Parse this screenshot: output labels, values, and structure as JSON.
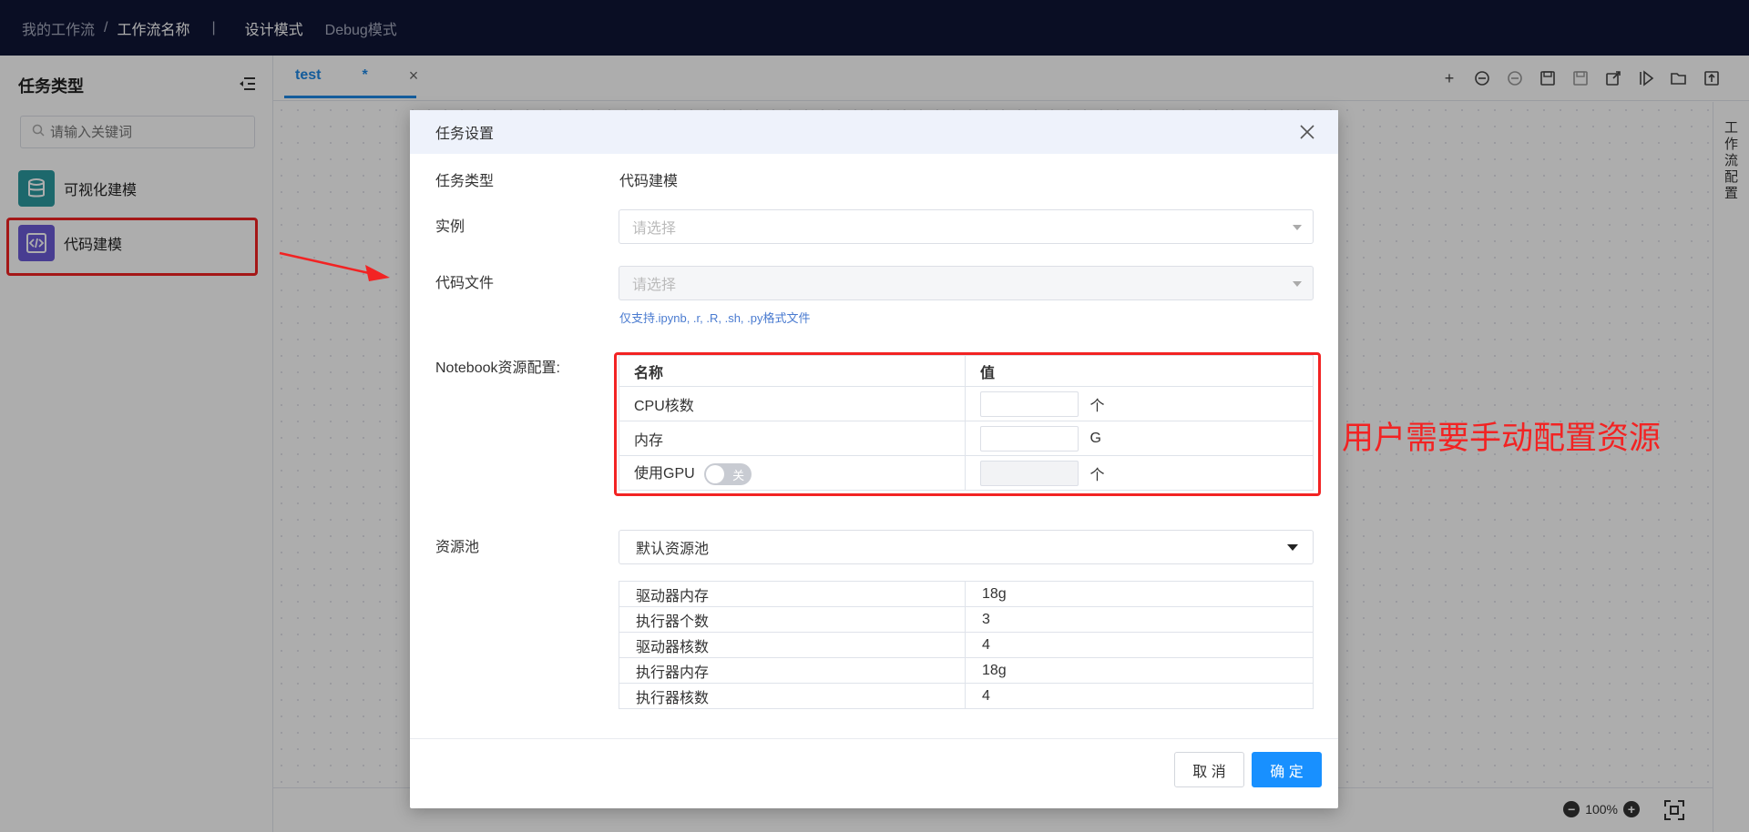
{
  "topbar": {
    "breadcrumb_root": "我的工作流",
    "breadcrumb_sep": "/",
    "breadcrumb_current": "工作流名称",
    "divider": "|",
    "mode_design": "设计模式",
    "mode_debug": "Debug模式",
    "bg_color": "#0f1535"
  },
  "sidebar": {
    "title": "任务类型",
    "search_placeholder": "请输入关键词",
    "items": [
      {
        "label": "可视化建模",
        "icon": "database-icon",
        "color": "#2b9aa0"
      },
      {
        "label": "代码建模",
        "icon": "code-icon",
        "color": "#6b5bd6"
      }
    ]
  },
  "tabs": [
    {
      "label": "test",
      "modified": "*",
      "close": "×"
    }
  ],
  "right_panel": {
    "label": "工作流配置"
  },
  "zoom": {
    "value": "100%"
  },
  "modal": {
    "title": "任务设置",
    "task_type_label": "任务类型",
    "task_type_value": "代码建模",
    "instance_label": "实例",
    "instance_placeholder": "请选择",
    "code_file_label": "代码文件",
    "code_file_placeholder": "请选择",
    "code_file_hint": "仅支持.ipynb, .r, .R, .sh, .py格式文件",
    "notebook_label": "Notebook资源配置:",
    "notebook_table": {
      "headers": [
        "名称",
        "值"
      ],
      "rows": [
        {
          "name": "CPU核数",
          "unit": "个"
        },
        {
          "name": "内存",
          "unit": "G"
        },
        {
          "name": "使用GPU",
          "toggle": "关",
          "unit": "个"
        }
      ]
    },
    "pool_label": "资源池",
    "pool_value": "默认资源池",
    "pool_table": [
      {
        "name": "驱动器内存",
        "value": "18g"
      },
      {
        "name": "执行器个数",
        "value": "3"
      },
      {
        "name": "驱动器核数",
        "value": "4"
      },
      {
        "name": "执行器内存",
        "value": "18g"
      },
      {
        "name": "执行器核数",
        "value": "4"
      }
    ],
    "cancel": "取 消",
    "ok": "确 定",
    "ok_color": "#1890ff"
  },
  "annotation": {
    "text": "用户需要手动配置资源",
    "color": "#f22323"
  }
}
